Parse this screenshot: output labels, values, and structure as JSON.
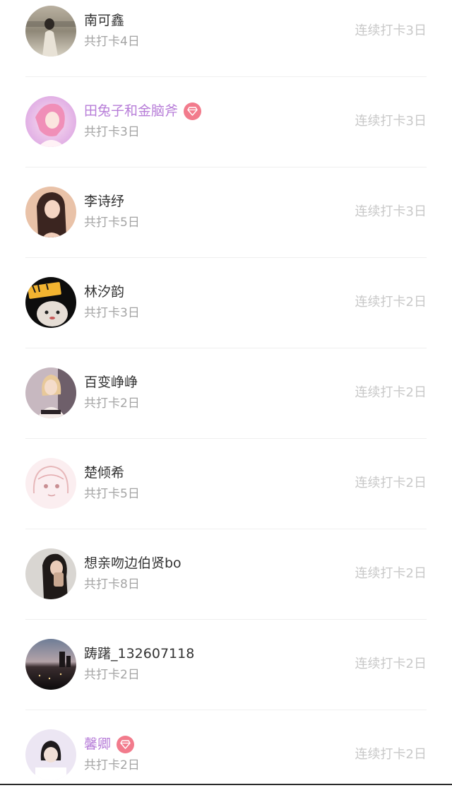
{
  "rows": [
    {
      "name": "南可鑫",
      "vip": false,
      "total": "共打卡4日",
      "streak": "连续打卡3日",
      "avatar": "avatar-1"
    },
    {
      "name": "田兔子和金脑斧",
      "vip": true,
      "total": "共打卡3日",
      "streak": "连续打卡3日",
      "avatar": "avatar-2"
    },
    {
      "name": "李诗纾",
      "vip": false,
      "total": "共打卡5日",
      "streak": "连续打卡3日",
      "avatar": "avatar-3"
    },
    {
      "name": "林汐韵",
      "vip": false,
      "total": "共打卡3日",
      "streak": "连续打卡2日",
      "avatar": "avatar-4"
    },
    {
      "name": "百变峥峥",
      "vip": false,
      "total": "共打卡2日",
      "streak": "连续打卡2日",
      "avatar": "avatar-5"
    },
    {
      "name": "楚倾希",
      "vip": false,
      "total": "共打卡5日",
      "streak": "连续打卡2日",
      "avatar": "avatar-6"
    },
    {
      "name": "想亲吻边伯贤bo",
      "vip": false,
      "total": "共打卡8日",
      "streak": "连续打卡2日",
      "avatar": "avatar-7"
    },
    {
      "name": "踌躇_132607118",
      "vip": false,
      "total": "共打卡2日",
      "streak": "连续打卡2日",
      "avatar": "avatar-8"
    },
    {
      "name": "馨卿",
      "vip": true,
      "total": "共打卡2日",
      "streak": "连续打卡2日",
      "avatar": "avatar-9"
    }
  ],
  "colors": {
    "name": "#333333",
    "vip_name": "#b77dd8",
    "badge": "#f27b8c",
    "subtext": "#a4a4a4",
    "streak": "#c8c8c8"
  }
}
